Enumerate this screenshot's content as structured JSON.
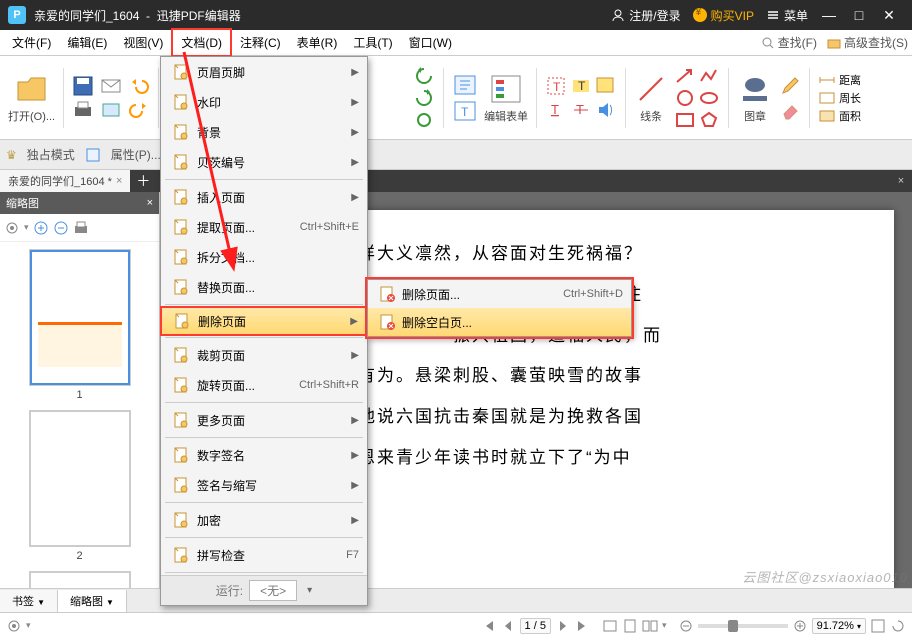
{
  "titlebar": {
    "doc_title": "亲爱的同学们_1604",
    "app_name": "迅捷PDF编辑器",
    "register_login": "注册/登录",
    "buy_vip": "购买VIP",
    "menu": "菜单"
  },
  "menubar": {
    "items": [
      "文件(F)",
      "编辑(E)",
      "视图(V)",
      "文档(D)",
      "注释(C)",
      "表单(R)",
      "工具(T)",
      "窗口(W)"
    ],
    "search": "查找(F)",
    "adv_search": "高级查找(S)"
  },
  "ribbon": {
    "open": "打开(O)...",
    "edit_form": "编辑表单",
    "lines": "线条",
    "image": "图章",
    "dist": "距离",
    "perim": "周长",
    "area": "面积"
  },
  "modebar": {
    "exclusive": "独占模式",
    "properties": "属性(P)..."
  },
  "tabbar": {
    "tab1": "亲爱的同学们_1604 *"
  },
  "thumbs": {
    "title": "缩略图",
    "p1": "1",
    "p2": "2"
  },
  "bottom_tabs": {
    "bookmark": "书签",
    "thumbs": "缩略图"
  },
  "status": {
    "page": "1 / 5",
    "zoom": "91.72%"
  },
  "page_text": {
    "l1": "他们为什么能够这样大义凛然，从容面对生死祸福？",
    "l2": "他们的心中，他们和祖国在一起，祖国人民永远记住",
    "l3": "　　　　　　　　　　　　　振兴祖国，造福人民，而",
    "l4": "，奋发图强，积极有为。悬梁刺股、囊萤映雪的故事",
    "l5": "，苏秦终成大儒，他说六国抗击秦国就是为挽救各国",
    "l6": "并而做的努力；周恩来青少年读书时就立下了“为中"
  },
  "dropdown": {
    "items": [
      {
        "label": "页眉页脚",
        "arrow": true
      },
      {
        "label": "水印",
        "arrow": true
      },
      {
        "label": "背景",
        "arrow": true
      },
      {
        "label": "贝茨编号",
        "arrow": true
      },
      {
        "hr": true
      },
      {
        "label": "插入页面",
        "arrow": true
      },
      {
        "label": "提取页面...",
        "sc": "Ctrl+Shift+E"
      },
      {
        "label": "拆分文档..."
      },
      {
        "label": "替换页面..."
      },
      {
        "hr": true
      },
      {
        "label": "删除页面",
        "arrow": true,
        "hl": true
      },
      {
        "hr": true
      },
      {
        "label": "裁剪页面",
        "arrow": true
      },
      {
        "label": "旋转页面...",
        "sc": "Ctrl+Shift+R"
      },
      {
        "hr": true
      },
      {
        "label": "更多页面",
        "arrow": true
      },
      {
        "hr": true
      },
      {
        "label": "数字签名",
        "arrow": true
      },
      {
        "label": "签名与缩写",
        "arrow": true
      },
      {
        "hr": true
      },
      {
        "label": "加密",
        "arrow": true
      },
      {
        "hr": true
      },
      {
        "label": "拼写检查",
        "sc": "F7"
      },
      {
        "hr": true
      }
    ],
    "footer_label": "运行:",
    "footer_value": "<无>"
  },
  "submenu": {
    "items": [
      {
        "label": "删除页面...",
        "sc": "Ctrl+Shift+D"
      },
      {
        "label": "删除空白页...",
        "hl": true
      }
    ]
  },
  "watermark": "云图社区@zsxiaoxiao010"
}
